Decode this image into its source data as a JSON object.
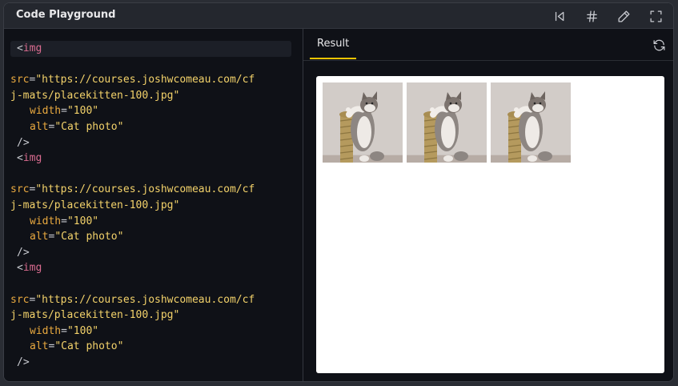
{
  "window": {
    "title": "Code Playground"
  },
  "toolbar": {
    "buttons": [
      {
        "name": "reset-icon"
      },
      {
        "name": "hash-icon"
      },
      {
        "name": "pencil-icon"
      },
      {
        "name": "fullscreen-icon"
      }
    ]
  },
  "editor": {
    "lines": [
      {
        "tag": "<img"
      },
      {
        "blank": true
      },
      {
        "attr": "src",
        "value": "\"https://courses.joshwcomeau.com/cf"
      },
      {
        "continuation": "j-mats/placekitten-100.jpg\""
      },
      {
        "attr": "width",
        "value": "\"100\""
      },
      {
        "attr": "alt",
        "value": "\"Cat photo\""
      },
      {
        "close": "/>"
      },
      {
        "tag": "<img"
      },
      {
        "blank": true
      },
      {
        "attr": "src",
        "value": "\"https://courses.joshwcomeau.com/cf"
      },
      {
        "continuation": "j-mats/placekitten-100.jpg\""
      },
      {
        "attr": "width",
        "value": "\"100\""
      },
      {
        "attr": "alt",
        "value": "\"Cat photo\""
      },
      {
        "close": "/>"
      },
      {
        "tag": "<img"
      },
      {
        "blank": true
      },
      {
        "attr": "src",
        "value": "\"https://courses.joshwcomeau.com/cf"
      },
      {
        "continuation": "j-mats/placekitten-100.jpg\""
      },
      {
        "attr": "width",
        "value": "\"100\""
      },
      {
        "attr": "alt",
        "value": "\"Cat photo\""
      },
      {
        "close": "/>"
      }
    ]
  },
  "preview": {
    "tab_label": "Result",
    "refresh_icon": "refresh-icon",
    "images": [
      {
        "alt": "Cat photo"
      },
      {
        "alt": "Cat photo"
      },
      {
        "alt": "Cat photo"
      }
    ]
  },
  "colors": {
    "accent": "#f0c400",
    "tag": "#d96b8f",
    "attr": "#e9a93f",
    "value": "#f3d26a"
  }
}
